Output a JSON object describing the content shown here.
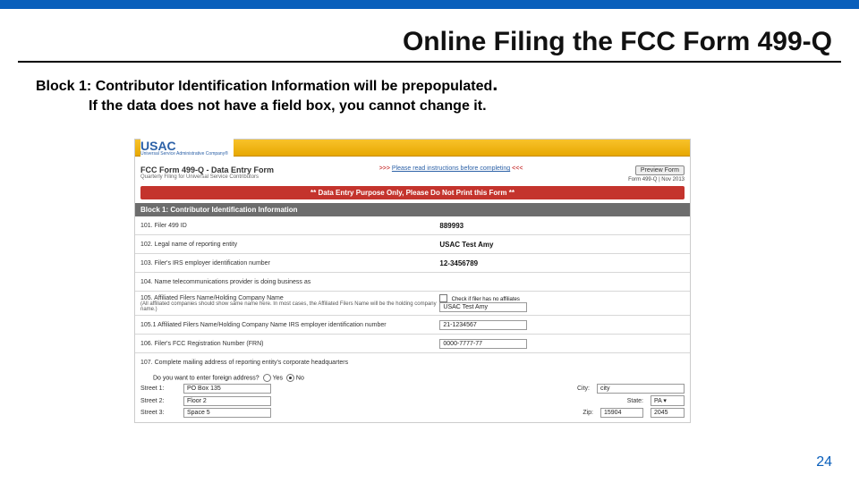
{
  "slide": {
    "title": "Online Filing the FCC Form 499-Q",
    "page_number": "24"
  },
  "body": {
    "block_label": "Block 1:",
    "line1_rest": "  Contributor Identification Information will be prepopulated",
    "period": ".",
    "line2": "If the data does not have a field box, you cannot change it."
  },
  "form": {
    "logo": "USAC",
    "logo_sub": "Universal Service Administrative Company®",
    "title": "FCC Form 499-Q - Data Entry Form",
    "subtitle": "Quarterly Filing for Universal Service Contributors",
    "instr_pre": ">>> ",
    "instr_link": "Please read instructions before completing",
    "instr_post": " <<<",
    "red_banner": "** Data Entry Purpose Only, Please Do Not Print this Form **",
    "preview_btn": "Preview Form",
    "form_stamp": "Form 499-Q | Nov 2013",
    "block_header": "Block 1: Contributor Identification Information",
    "rows": {
      "r101_label": "101. Filer 499 ID",
      "r101_value": "889993",
      "r102_label": "102. Legal name of reporting entity",
      "r102_value": "USAC Test Amy",
      "r103_label": "103. Filer's IRS employer identification number",
      "r103_value": "12-3456789",
      "r104_label": "104. Name telecommunications provider is doing business as",
      "r104_value": "",
      "r105_label": "105. Affiliated Filers Name/Holding Company Name",
      "r105_sub": "(All affiliated companies should show same name here. In most cases, the Affiliated Filers Name will be the holding company name.)",
      "r105_check": "Check if filer has no affiliates",
      "r105_value": "USAC Test Amy",
      "r1051_label": "105.1 Affiliated Filers Name/Holding Company Name IRS employer identification number",
      "r1051_value": "21-1234567",
      "r106_label": "106. Filer's FCC Registration Number (FRN)",
      "r106_value": "0000-7777-77",
      "r107_label": "107. Complete mailing address of reporting entity's corporate headquarters"
    },
    "addr": {
      "foreign_q": "Do you want to enter foreign address?",
      "yes": "Yes",
      "no": "No",
      "street1_lbl": "Street 1:",
      "street1": "PO Box 135",
      "street2_lbl": "Street 2:",
      "street2": "Floor 2",
      "street3_lbl": "Street 3:",
      "street3": "Space 5",
      "city_lbl": "City:",
      "city": "city",
      "state_lbl": "State:",
      "state": "PA",
      "zip_lbl": "Zip:",
      "zip": "15904",
      "zip4": "2045"
    }
  }
}
